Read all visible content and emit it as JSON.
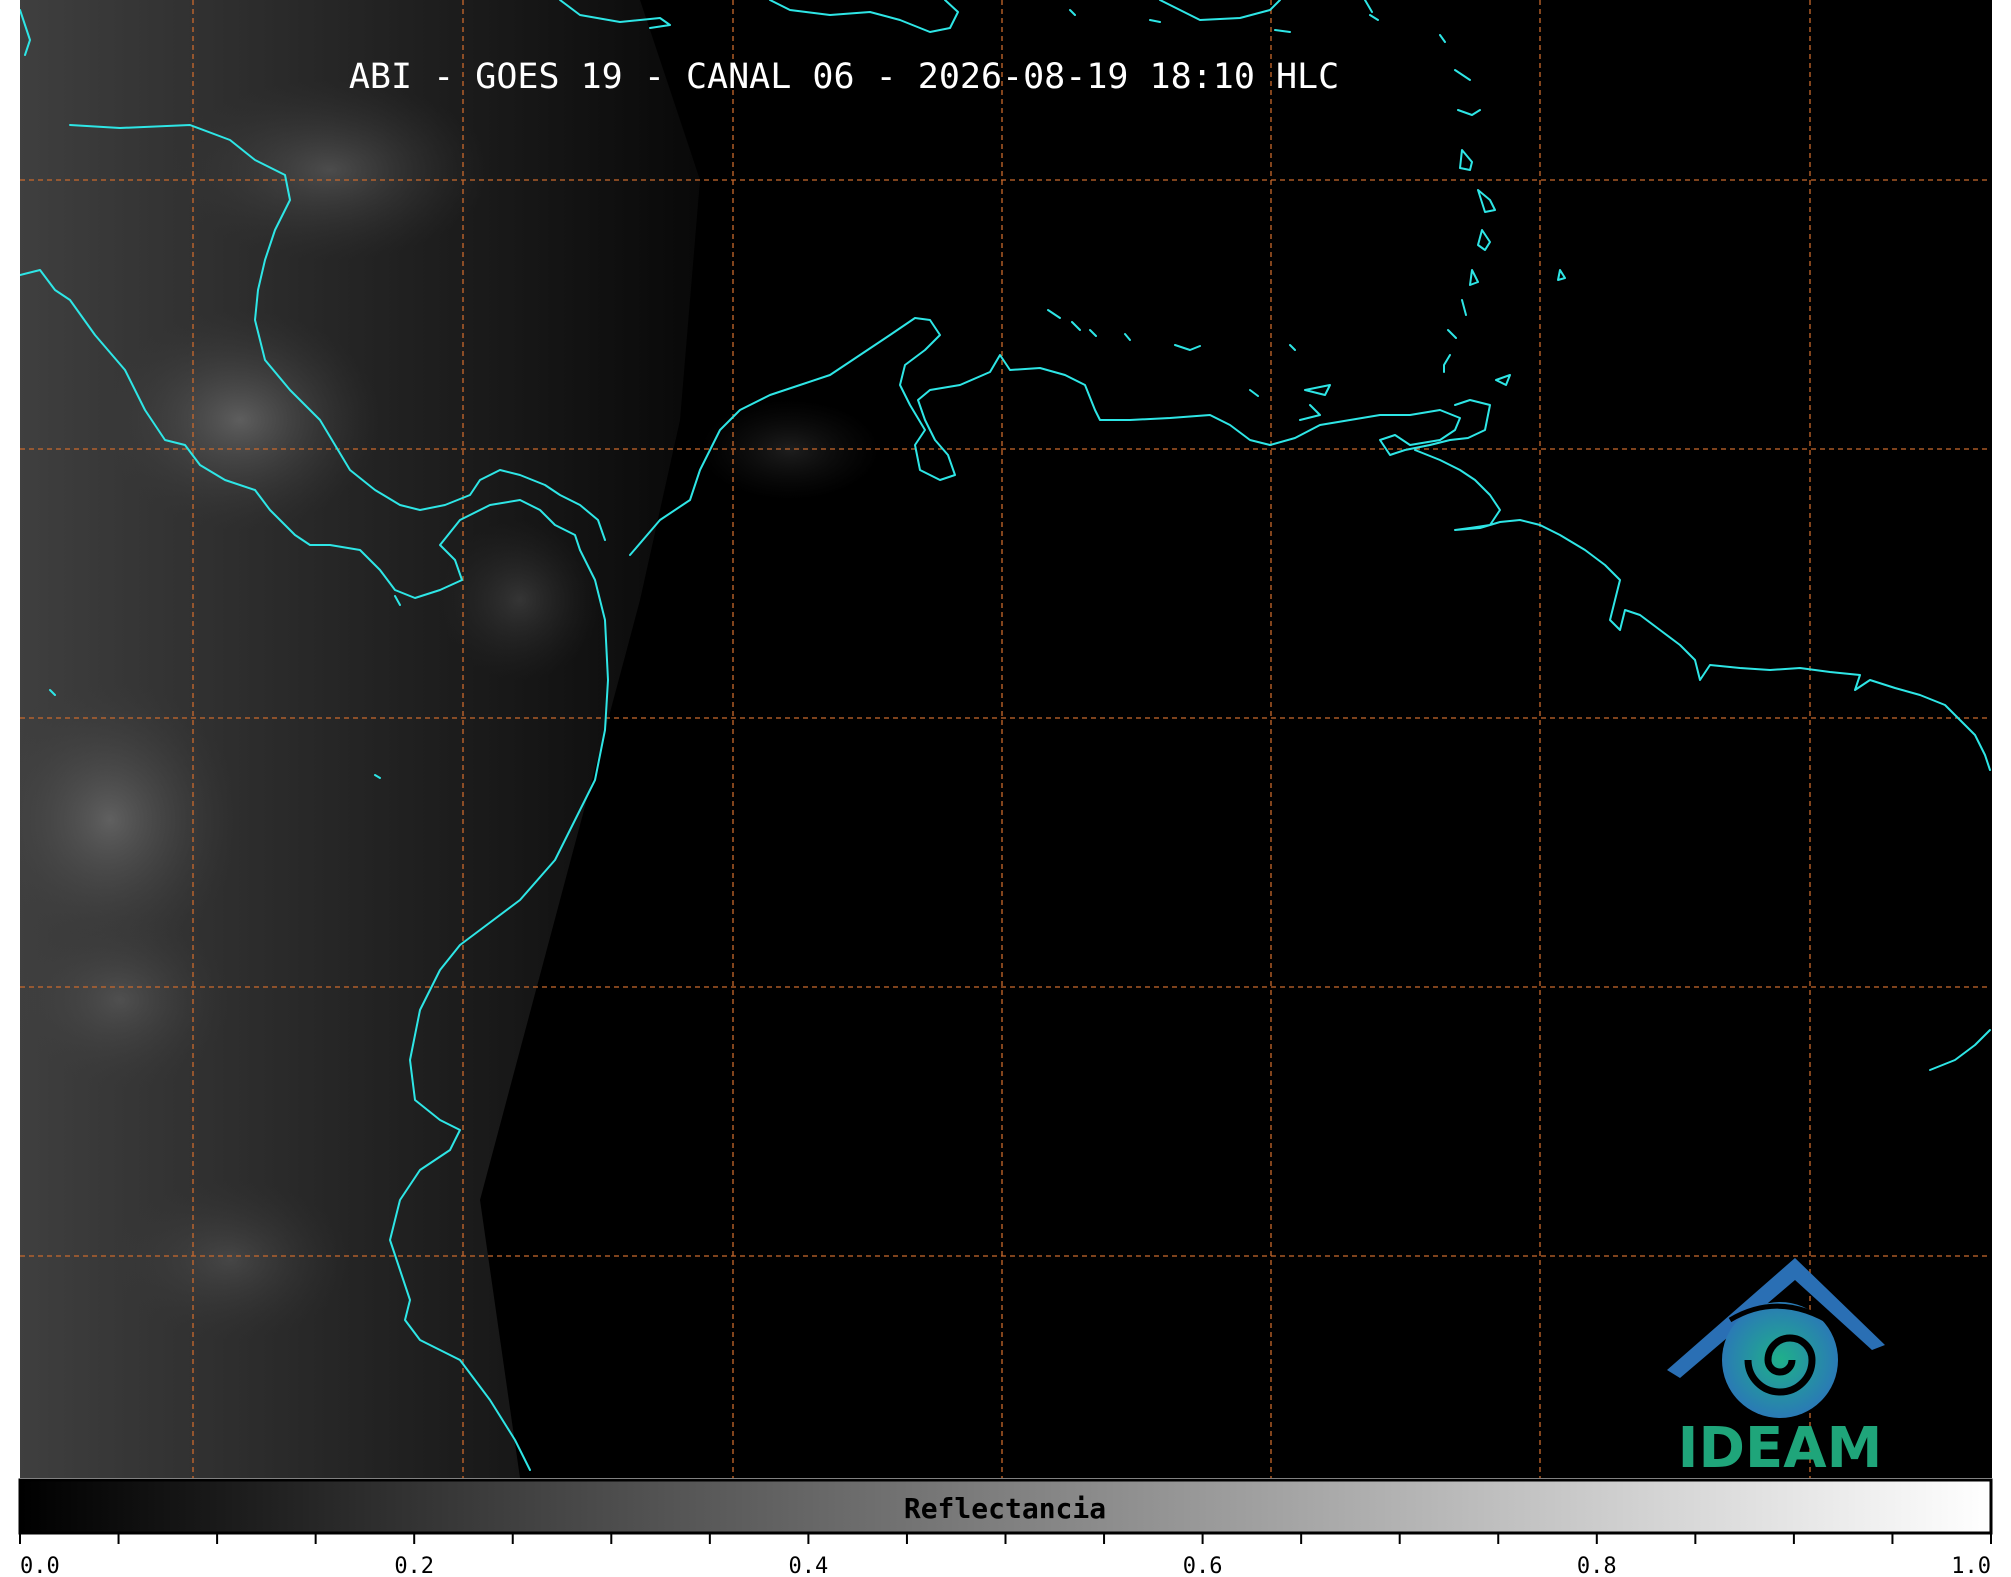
{
  "title": "ABI - GOES 19 - CANAL 06 - 2026-08-19 18:10 HLC",
  "colorbar": {
    "label": "Reflectancia",
    "min": 0.0,
    "max": 1.0,
    "tick_labels": [
      "0.0",
      "0.2",
      "0.4",
      "0.6",
      "0.8",
      "1.0"
    ],
    "minor_tick_step": 0.05
  },
  "logo": {
    "text": "IDEAM",
    "color": "#1fa57a",
    "roof_color": "#2a6fb4"
  },
  "colors": {
    "coastline": "#2ee6e6",
    "gridline": "#c9692c",
    "background": "#000000"
  }
}
